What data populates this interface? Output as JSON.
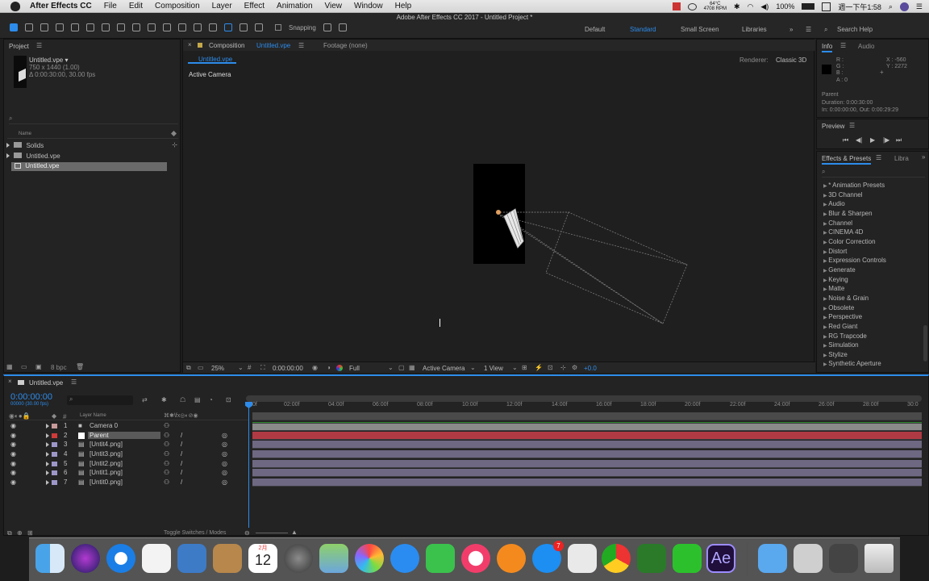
{
  "menubar": {
    "app_name": "After Effects CC",
    "items": [
      "File",
      "Edit",
      "Composition",
      "Layer",
      "Effect",
      "Animation",
      "View",
      "Window",
      "Help"
    ],
    "weather_top": "64°C",
    "weather_bottom": "4708 RPM",
    "battery": "100%",
    "clock": "週一下午1:58"
  },
  "window": {
    "title": "Adobe After Effects CC 2017 - Untitled Project *"
  },
  "toolbar": {
    "snapping_label": "Snapping",
    "workspaces": [
      "Default",
      "Standard",
      "Small Screen",
      "Libraries"
    ],
    "active_workspace": "Standard",
    "search_placeholder": "Search Help"
  },
  "project": {
    "panel_title": "Project",
    "item_name": "Untitled.vpe ▾",
    "item_dims": "750 x 1440 (1.00)",
    "item_duration": "Δ 0:00:30:00, 30.00 fps",
    "column_name": "Name",
    "items": [
      "Solids",
      "Untitled.vpe",
      "Untitled.vpe"
    ],
    "bpc": "8 bpc"
  },
  "composition": {
    "tab_label": "Composition",
    "tab_name": "Untitled.vpe",
    "footage_label": "Footage (none)",
    "subtab": "Untitled.vpe",
    "renderer_label": "Renderer:",
    "renderer_value": "Classic 3D",
    "view_label": "Active Camera",
    "zoom": "25%",
    "timecode": "0:00:00:00",
    "resolution": "Full",
    "camera": "Active Camera",
    "views": "1 View",
    "exposure": "+0.0"
  },
  "info": {
    "title": "Info",
    "audio_tab": "Audio",
    "r": "R :",
    "g": "G :",
    "b": "B :",
    "a": "A : 0",
    "x": "X : -560",
    "y": "Y : 2272",
    "layer": "Parent",
    "duration": "Duration: 0:00:30:00",
    "inout": "In: 0:00:00:00, Out: 0:00:29:29"
  },
  "preview": {
    "title": "Preview"
  },
  "effects": {
    "title": "Effects & Presets",
    "libraries_tab": "Libra",
    "items": [
      "* Animation Presets",
      "3D Channel",
      "Audio",
      "Blur & Sharpen",
      "Channel",
      "CINEMA 4D",
      "Color Correction",
      "Distort",
      "Expression Controls",
      "Generate",
      "Keying",
      "Matte",
      "Noise & Grain",
      "Obsolete",
      "Perspective",
      "Red Giant",
      "RG Trapcode",
      "Simulation",
      "Stylize",
      "Synthetic Aperture"
    ]
  },
  "timeline": {
    "tab": "Untitled.vpe",
    "timecode": "0:00:00:00",
    "frames": "00000 (30.00 fps)",
    "col_layer_name": "Layer Name",
    "toggle_label": "Toggle Switches / Modes",
    "ruler": [
      "0f",
      "02:00f",
      "04:00f",
      "06:00f",
      "08:00f",
      "10:00f",
      "12:00f",
      "14:00f",
      "16:00f",
      "18:00f",
      "20:00f",
      "22:00f",
      "24:00f",
      "26:00f",
      "28:00f",
      "30:0"
    ],
    "layers": [
      {
        "num": "1",
        "name": "Camera 0",
        "color": "#c89a9a"
      },
      {
        "num": "2",
        "name": "Parent",
        "color": "#cf3a3a"
      },
      {
        "num": "3",
        "name": "[Untit4.png]",
        "color": "#9d97c9"
      },
      {
        "num": "4",
        "name": "[Untit3.png]",
        "color": "#9d97c9"
      },
      {
        "num": "5",
        "name": "[Untit2.png]",
        "color": "#9d97c9"
      },
      {
        "num": "6",
        "name": "[Untit1.png]",
        "color": "#9d97c9"
      },
      {
        "num": "7",
        "name": "[Untit0.png]",
        "color": "#9d97c9"
      }
    ]
  },
  "dock": {
    "calendar_month": "2月",
    "calendar_day": "12",
    "badge": "7",
    "ae_label": "Ae"
  }
}
